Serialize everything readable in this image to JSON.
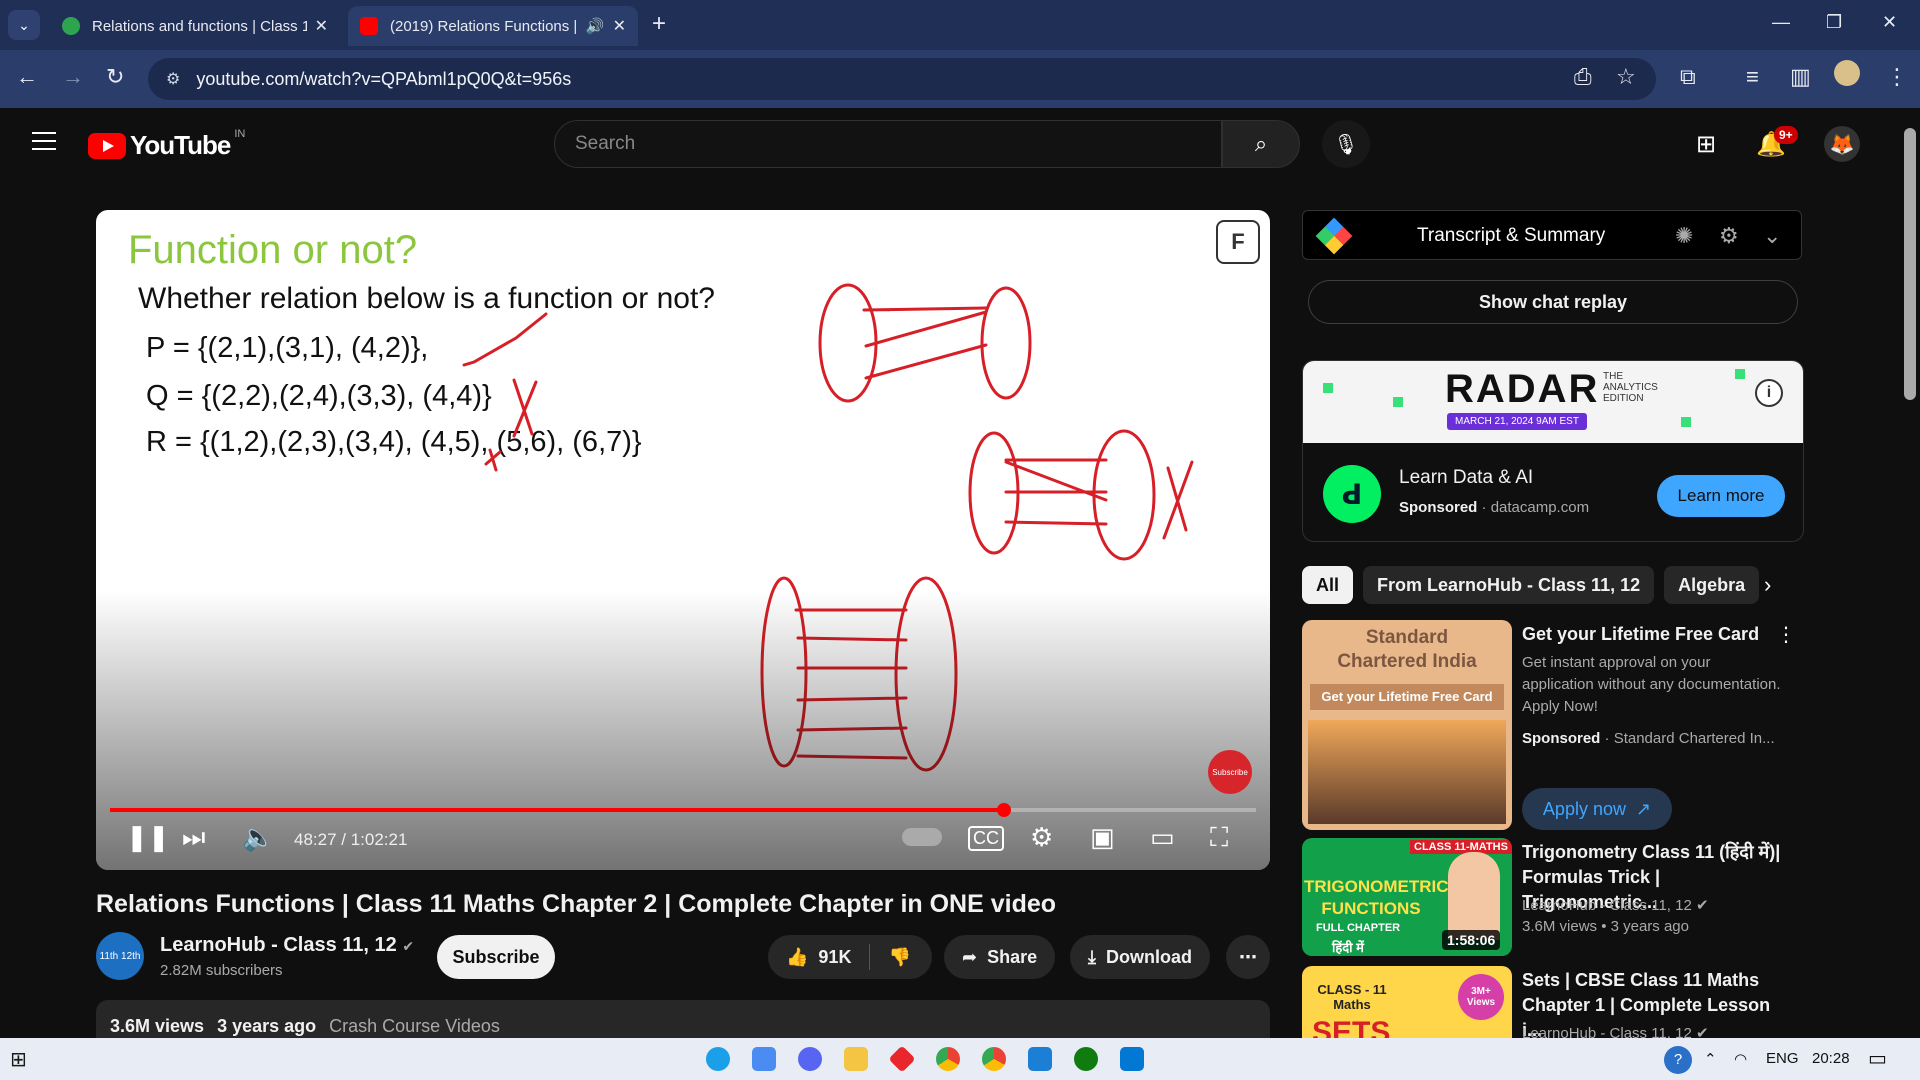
{
  "browser": {
    "tabs": [
      {
        "title": "Relations and functions | Class 1",
        "active": false
      },
      {
        "title": "(2019) Relations Functions |",
        "active": true
      }
    ],
    "url": "youtube.com/watch?v=QPAbml1pQ0Q&t=956s"
  },
  "youtube": {
    "logo_text": "YouTube",
    "country_code": "IN",
    "search_placeholder": "Search",
    "notifications_badge": "9+"
  },
  "video": {
    "slide": {
      "title": "Function or not?",
      "question": "Whether relation below is a function or not?",
      "lines": [
        "P = {(2,1),(3,1), (4,2)},",
        "Q = {(2,2),(2,4),(3,3), (4,4)}",
        "R = {(1,2),(2,3),(3,4), (4,5), (5,6), (6,7)}"
      ],
      "corner_logo": "F",
      "subscribe_bubble": "Subscribe"
    },
    "progress_fraction": 0.78,
    "time": "48:27 / 1:02:21",
    "title": "Relations Functions | Class 11 Maths Chapter 2 | Complete Chapter in ONE video",
    "channel": {
      "name": "LearnoHub - Class 11, 12",
      "subscribers": "2.82M subscribers",
      "avatar_text": "11th 12th"
    },
    "subscribe_label": "Subscribe",
    "likes": "91K",
    "share_label": "Share",
    "download_label": "Download",
    "description": {
      "views": "3.6M views",
      "age": "3 years ago",
      "tag": "Crash Course Videos"
    }
  },
  "sidebar": {
    "transcript_label": "Transcript & Summary",
    "chat_replay_label": "Show chat replay",
    "ad": {
      "banner_brand": "RADAR",
      "banner_sub": "THE ANALYTICS EDITION",
      "banner_date": "MARCH 21, 2024   9AM EST",
      "title": "Learn Data & AI",
      "sponsored": "Sponsored",
      "domain": "datacamp.com",
      "cta": "Learn more"
    },
    "chips": [
      "All",
      "From LearnoHub - Class 11, 12",
      "Algebra"
    ],
    "recommendations": [
      {
        "title": "Get your Lifetime Free Card",
        "desc": "Get instant approval on your application without any documentation. Apply Now!",
        "sponsored": "Sponsored",
        "advertiser": "Standard Chartered In...",
        "cta": "Apply now",
        "thumb_title": "Standard Chartered India",
        "thumb_strip": "Get your Lifetime Free Card"
      },
      {
        "title": "Trigonometry Class 11 (हिंदी में)| Formulas Trick | Trigonometric...",
        "channel": "LearnoHub - Class 11, 12",
        "meta": "3.6M views • 3 years ago",
        "duration": "1:58:06",
        "thumb_text": "TRIGONOMETRIC FUNCTIONS",
        "thumb_tag": "CLASS 11-MATHS",
        "thumb_sub": "FULL CHAPTER",
        "thumb_hindi": "हिंदी में"
      },
      {
        "title": "Sets | CBSE Class 11 Maths Chapter 1 | Complete Lesson i...",
        "channel": "LearnoHub - Class 11, 12",
        "thumb_text": "SETS",
        "thumb_tag": "CLASS - 11 Maths",
        "thumb_badge": "3M+ Views"
      }
    ]
  },
  "taskbar": {
    "language": "ENG",
    "time": "20:28"
  },
  "colors": {
    "yt_red": "#ff0000",
    "accent_blue": "#3ea6ff",
    "browser_frame": "#1f2f55"
  }
}
